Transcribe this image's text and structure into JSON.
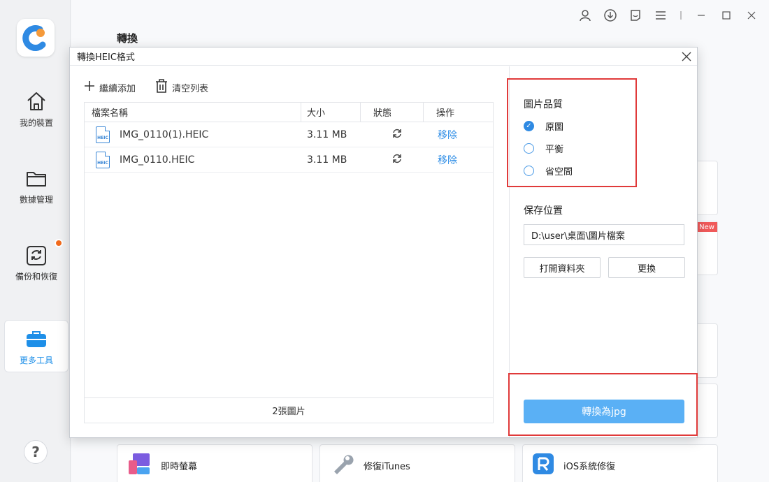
{
  "sidebar": {
    "items": [
      {
        "label": "我的裝置",
        "icon": "home-icon"
      },
      {
        "label": "數據管理",
        "icon": "folder-icon"
      },
      {
        "label": "備份和恢復",
        "icon": "backup-restore-icon"
      },
      {
        "label": "更多工具",
        "icon": "toolbox-icon"
      }
    ],
    "help_label": "?"
  },
  "main": {
    "title": "轉換",
    "new_badge": "New",
    "bottom_tools": [
      {
        "label": "即時螢幕"
      },
      {
        "label": "修復iTunes"
      },
      {
        "label": "iOS系統修復"
      }
    ]
  },
  "dialog": {
    "title": "轉換HEIC格式",
    "toolbar": {
      "add_label": "繼續添加",
      "clear_label": "清空列表"
    },
    "table": {
      "headers": [
        "檔案名稱",
        "大小",
        "狀態",
        "操作"
      ],
      "rows": [
        {
          "name": "IMG_0110(1).HEIC",
          "size": "3.11 MB",
          "action": "移除"
        },
        {
          "name": "IMG_0110.HEIC",
          "size": "3.11 MB",
          "action": "移除"
        }
      ],
      "icon_text": "HEIC",
      "footer": "2張圖片"
    },
    "quality": {
      "title": "圖片品質",
      "options": [
        "原圖",
        "平衡",
        "省空間"
      ],
      "selected": "原圖"
    },
    "save": {
      "title": "保存位置",
      "path": "D:\\user\\桌面\\圖片檔案",
      "open_label": "打開資料夾",
      "change_label": "更換"
    },
    "convert_label": "轉換為jpg"
  },
  "colors": {
    "accent": "#2f8ae3",
    "highlight": "#e03a3a",
    "convert": "#5ab0f5"
  }
}
